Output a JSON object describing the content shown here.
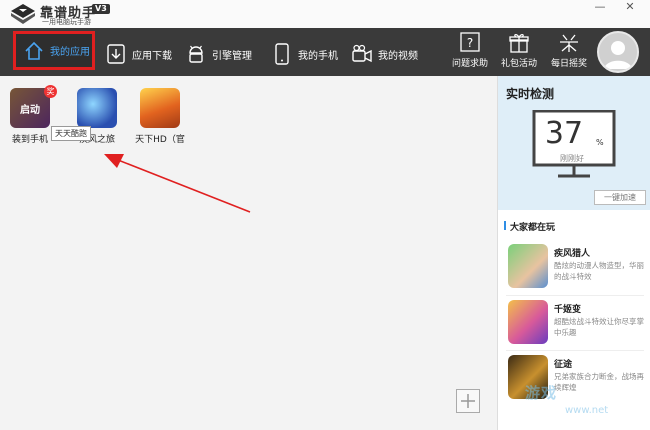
{
  "titlebar": {
    "brand_name": "靠谱助手",
    "version": "V3",
    "tagline": "一用电脑玩手游",
    "minimize": "—",
    "close": "✕"
  },
  "nav": {
    "items": [
      {
        "label": "我的应用",
        "icon": "house-icon",
        "active": true
      },
      {
        "label": "应用下载",
        "icon": "download-icon"
      },
      {
        "label": "引擎管理",
        "icon": "android-icon"
      },
      {
        "label": "我的手机",
        "icon": "phone-icon"
      },
      {
        "label": "我的视频",
        "icon": "video-camera-icon"
      }
    ],
    "right": [
      {
        "label": "问题求助",
        "icon": "help-icon"
      },
      {
        "label": "礼包活动",
        "icon": "gift-icon"
      },
      {
        "label": "每日摇奖",
        "icon": "lottery-icon"
      }
    ],
    "avatar": "user-avatar-icon"
  },
  "main": {
    "apps": [
      {
        "name": "装到手机",
        "overlay": "启动",
        "badge": "奖"
      },
      {
        "name": "疾风之旅"
      },
      {
        "name": "天下HD（官"
      }
    ],
    "tooltip": "天天酷跑",
    "annotation_color": "#e02020",
    "add_label": "+"
  },
  "sidepanel": {
    "monitor_title": "实时检测",
    "monitor_value": "37",
    "monitor_unit": "%",
    "monitor_status": "刚刚好",
    "accelerate_label": "一键加速",
    "popular_title": "大家都在玩",
    "popular": [
      {
        "name": "疾风猎人",
        "desc": "酷炫的动漫人物造型，华丽的战斗特效"
      },
      {
        "name": "千姬变",
        "desc": "超酷炫战斗特效让你尽享掌中乐趣"
      },
      {
        "name": "征途",
        "desc": "兄弟家族合力断金，战场再续辉煌"
      }
    ]
  },
  "watermark": {
    "text": "游戏",
    "sub": "www.net"
  },
  "colors": {
    "navbar": "#3a3a3a",
    "accent": "#4aa3f0",
    "highlight": "#e02020",
    "monitor_bg": "#dfeef8"
  }
}
